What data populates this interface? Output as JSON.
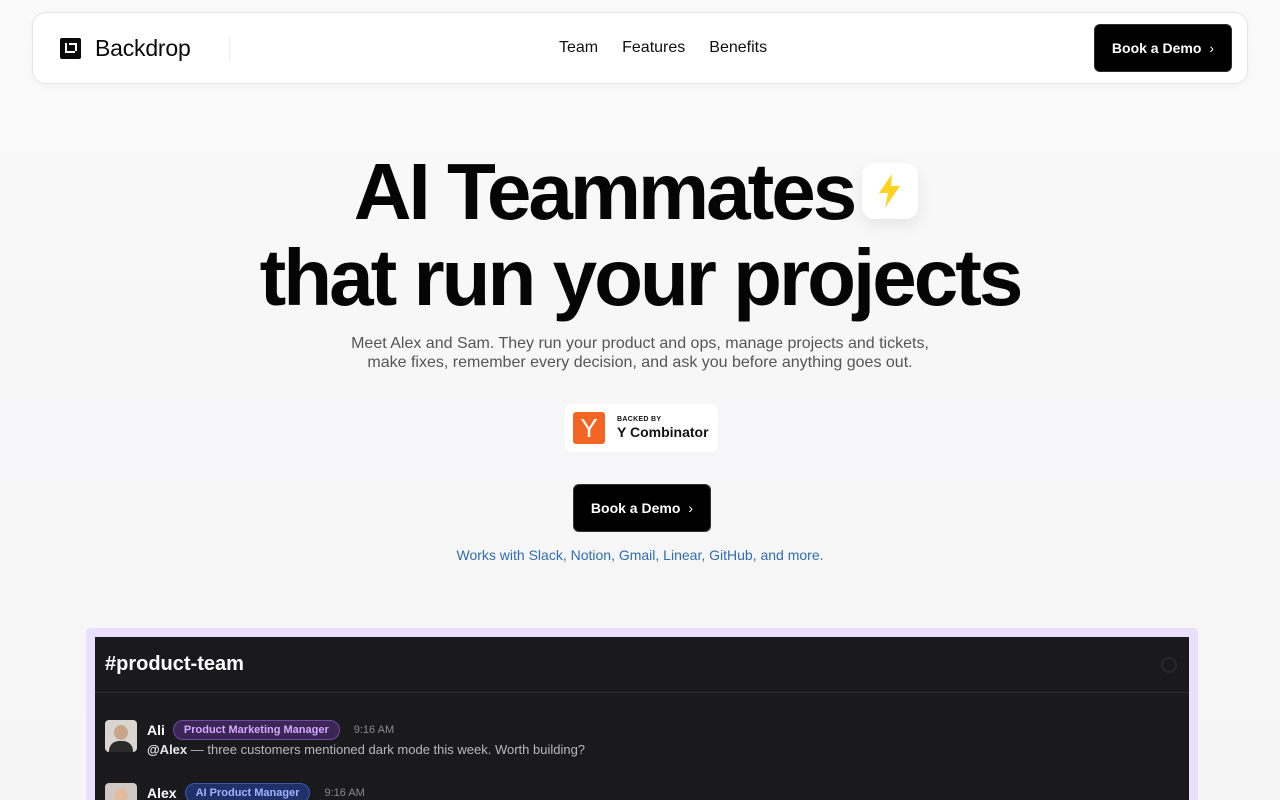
{
  "nav": {
    "brand": "Backdrop",
    "links": [
      "Team",
      "Features",
      "Benefits"
    ],
    "cta": "Book a Demo"
  },
  "hero": {
    "title_line1": "AI Teammates",
    "title_line2": "that run your projects",
    "sub_line1": "Meet Alex and Sam. They run your product and ops, manage projects and tickets,",
    "sub_line2": "make fixes, remember every decision, and ask you before anything goes out.",
    "backed_by_small": "BACKED BY",
    "backed_by_big": "Y Combinator",
    "yc_mark": "Y",
    "cta": "Book a Demo",
    "works_with": "Works with Slack, Notion, Gmail, Linear, GitHub, and more."
  },
  "slack": {
    "channel": "#product-team",
    "messages": [
      {
        "name": "Ali",
        "role": "Product Marketing Manager",
        "time": "9:16 AM",
        "mention": "@Alex",
        "text": " — three customers mentioned dark mode this week. Worth building?"
      },
      {
        "name": "Alex",
        "role": "AI Product Manager",
        "time": "9:16 AM"
      }
    ]
  },
  "icons": {
    "chevron": "chevron-right-icon",
    "bolt": "lightning-bolt-icon",
    "logo": "backdrop-logo-icon"
  },
  "colors": {
    "accent_black": "#000000",
    "yc_orange": "#f26522",
    "bolt_yellow": "#ffd21f",
    "link_blue": "#2f6db3",
    "panel_bg": "#1a1a1c",
    "panel_frame": "#e9e0ff"
  }
}
